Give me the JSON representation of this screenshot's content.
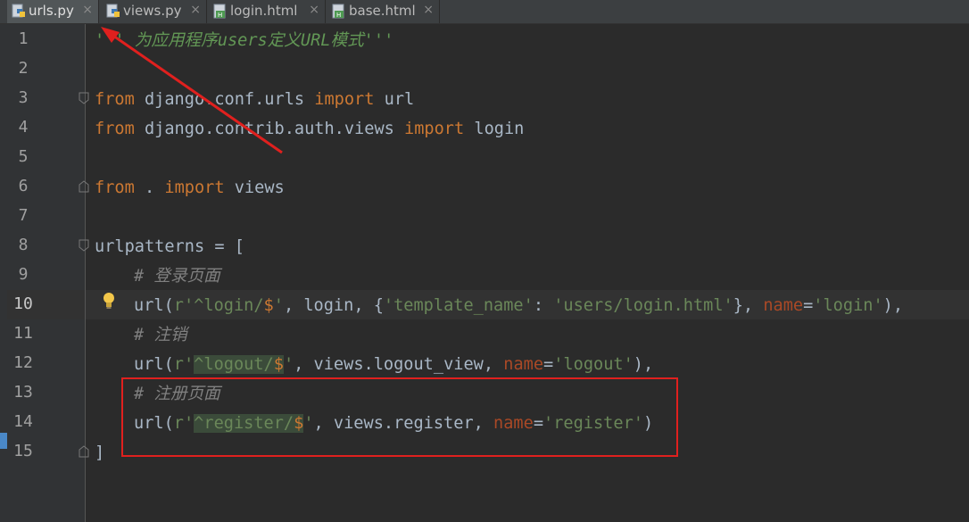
{
  "tabs": [
    {
      "label": "urls.py",
      "icon": "python-file-icon",
      "active": true
    },
    {
      "label": "views.py",
      "icon": "python-file-icon",
      "active": false
    },
    {
      "label": "login.html",
      "icon": "html-file-icon",
      "active": false
    },
    {
      "label": "base.html",
      "icon": "html-file-icon",
      "active": false
    }
  ],
  "close_glyph": "×",
  "line_numbers": [
    "1",
    "2",
    "3",
    "4",
    "5",
    "6",
    "7",
    "8",
    "9",
    "10",
    "11",
    "12",
    "13",
    "14",
    "15"
  ],
  "code": {
    "l1": {
      "doc": "''' 为应用程序users定义URL模式'''"
    },
    "l3": {
      "kw1": "from",
      "t1": " django.conf.urls ",
      "kw2": "import",
      "t2": " url"
    },
    "l4": {
      "kw1": "from",
      "t1": " django.contrib.auth.views ",
      "kw2": "import",
      "t2": " login"
    },
    "l6": {
      "kw1": "from",
      "t1": " . ",
      "kw2": "import",
      "t2": " views"
    },
    "l8": {
      "t1": "urlpatterns = ["
    },
    "l9": {
      "cmt": "# 登录页面"
    },
    "l10": {
      "t1": "url(",
      "s1": "r'",
      "rx1": "^",
      "s2": "login/",
      "rx2": "$",
      "s3": "'",
      "t2": ", login, {",
      "s4": "'template_name'",
      "t3": ": ",
      "s5": "'users/login.html'",
      "t4": "}, ",
      "p1": "name",
      "t5": "=",
      "s6": "'login'",
      "t6": "),"
    },
    "l11": {
      "cmt": "# 注销"
    },
    "l12": {
      "t1": "url(",
      "s1": "r'",
      "rx1": "^",
      "s2": "logout/",
      "rx2": "$",
      "s3": "'",
      "t2": ", views.logout_view, ",
      "p1": "name",
      "t5": "=",
      "s6": "'logout'",
      "t6": "),"
    },
    "l13": {
      "cmt": "# 注册页面"
    },
    "l14": {
      "t1": "url(",
      "s1": "r'",
      "rx1": "^",
      "s2": "register/",
      "rx2": "$",
      "s3": "'",
      "t2": ", views.register, ",
      "p1": "name",
      "t5": "=",
      "s6": "'register'",
      "t6": ")"
    },
    "l15": {
      "t1": "]"
    }
  },
  "annotations": {
    "highlight_color": "#e0201e",
    "arrow_color": "#e0201e"
  }
}
